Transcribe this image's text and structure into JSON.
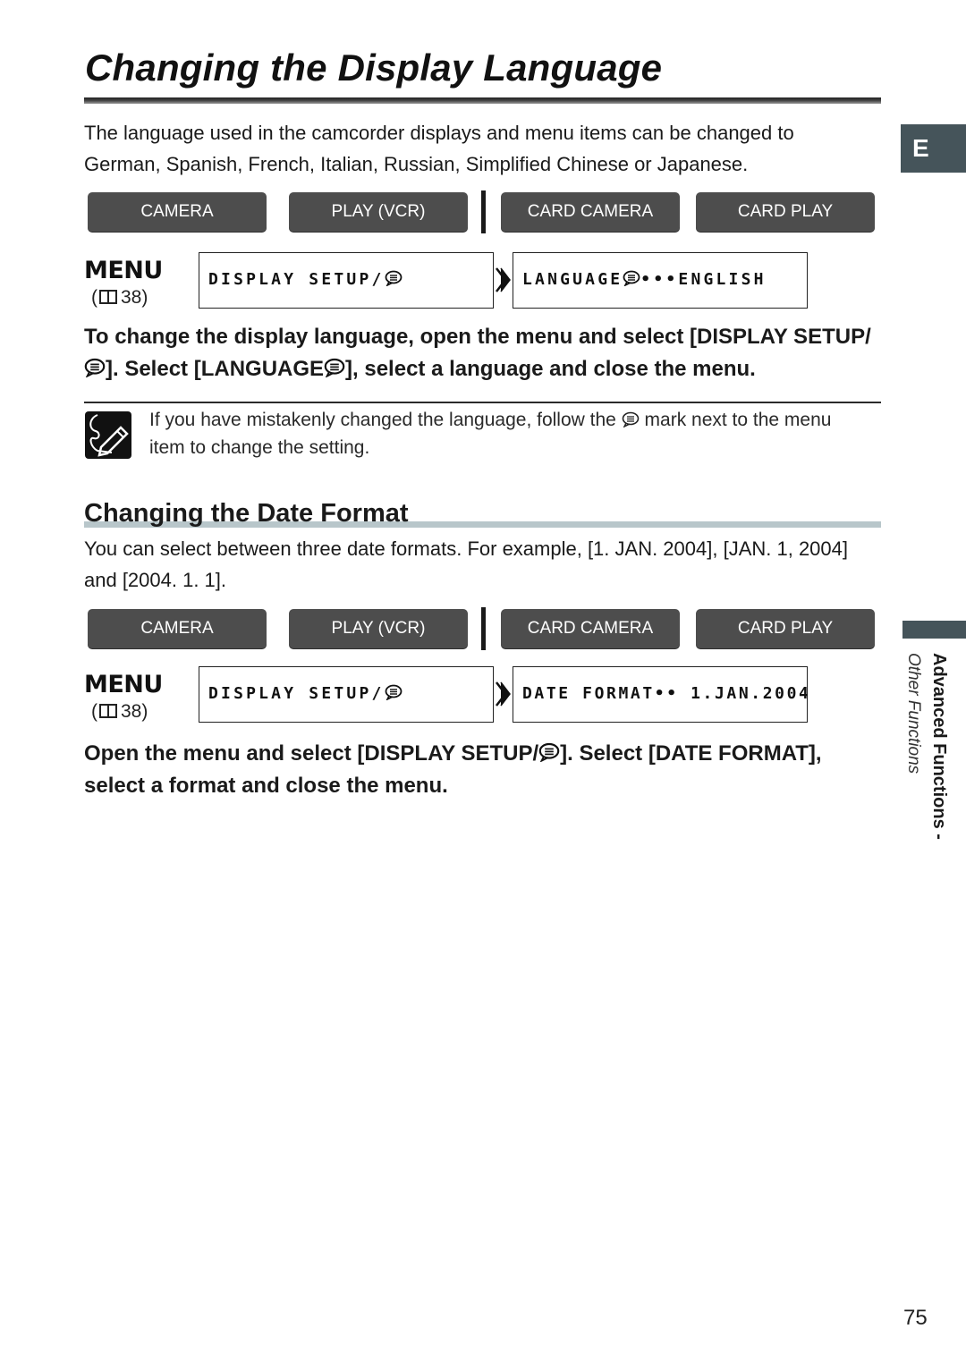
{
  "page": {
    "title": "Changing the Display Language",
    "language_tab": "E",
    "page_number": "75",
    "side_tab": {
      "section": "Advanced Functions -",
      "subsection": "Other Functions"
    }
  },
  "section1": {
    "intro": "The language used in the camcorder displays and menu items can be changed to German, Spanish, French, Italian, Russian, Simplified Chinese or Japanese.",
    "modes": [
      "CAMERA",
      "PLAY (VCR)",
      "CARD CAMERA",
      "CARD PLAY"
    ],
    "menu_label": "MENU",
    "menu_ref": "38",
    "lcd_menu": "DISPLAY SETUP/",
    "lcd_item": "LANGUAGE",
    "lcd_value": "•••ENGLISH",
    "instruction_part1": "To change the display language, open the menu and select [DISPLAY SETUP/",
    "instruction_part2": "]. Select [LANGUAGE",
    "instruction_part3": "], select a language and close the menu.",
    "note_part1": "If you have mistakenly changed the language, follow the",
    "note_part2": "mark next to the menu item to change the setting."
  },
  "section2": {
    "title": "Changing the Date Format",
    "intro": "You can select between three date formats. For example, [1. JAN. 2004], [JAN. 1, 2004] and [2004. 1. 1].",
    "modes": [
      "CAMERA",
      "PLAY (VCR)",
      "CARD CAMERA",
      "CARD PLAY"
    ],
    "menu_label": "MENU",
    "menu_ref": "38",
    "lcd_menu": "DISPLAY SETUP/",
    "lcd_item": "DATE FORMAT•• 1.JAN.2004",
    "instruction_part1": "Open the menu and select [DISPLAY SETUP/",
    "instruction_part2": "]. Select [DATE FORMAT], select a format and close the menu."
  },
  "icons": {
    "language_mark": "speech-bubble-icon",
    "book": "book-icon",
    "note": "pencil-note-icon",
    "arrow": "double-chevron-right-icon"
  },
  "colors": {
    "mode_button": "#4d4d4d",
    "tab": "#45545a",
    "section_rule": "#b8c6ca"
  }
}
